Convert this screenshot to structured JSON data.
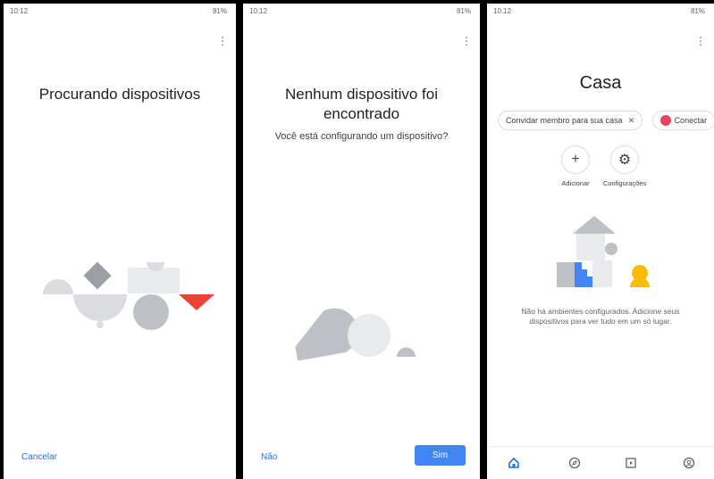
{
  "status_bar": {
    "time": "10:12",
    "signal": "81%"
  },
  "screen1": {
    "title": "Procurando dispositivos",
    "cancel_label": "Cancelar"
  },
  "screen2": {
    "title": "Nenhum dispositivo foi encontrado",
    "subtitle": "Você está configurando um dispositivo?",
    "no_label": "Não",
    "yes_label": "Sim"
  },
  "screen3": {
    "title": "Casa",
    "chips": [
      {
        "label": "Convidar membro para sua casa"
      },
      {
        "label": "Conectar"
      }
    ],
    "actions": [
      {
        "label": "Adicionar",
        "icon": "plus-icon"
      },
      {
        "label": "Configurações",
        "icon": "gear-icon"
      }
    ],
    "empty_message": "Não há ambientes configurados. Adicione seus dispositivos para ver tudo em um só lugar.",
    "nav": [
      "home-icon",
      "compass-icon",
      "media-icon",
      "account-icon"
    ]
  },
  "colors": {
    "accent": "#1a73e8",
    "button": "#4285f4",
    "red": "#ea4335",
    "yellow": "#fbbc04",
    "blue": "#4285f4"
  }
}
